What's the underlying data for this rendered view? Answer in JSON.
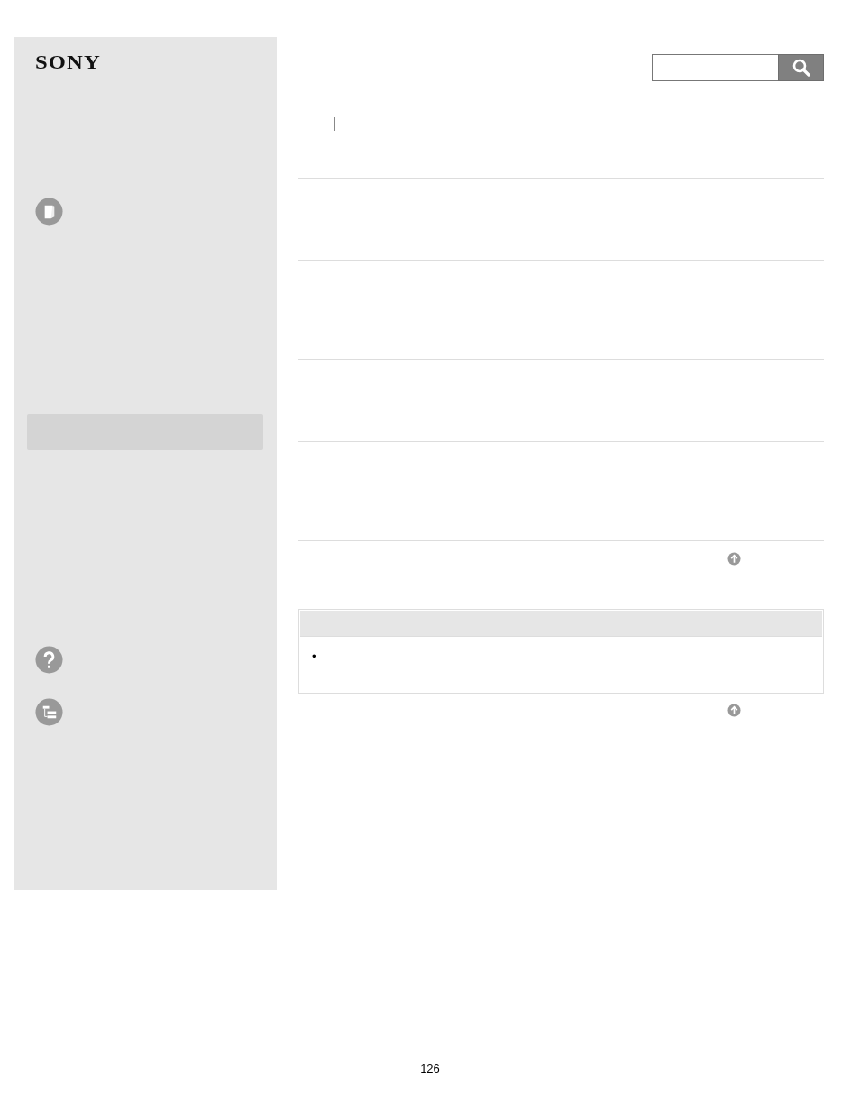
{
  "logo": "SONY",
  "note": {
    "bullet": "•"
  },
  "page_number": "126"
}
